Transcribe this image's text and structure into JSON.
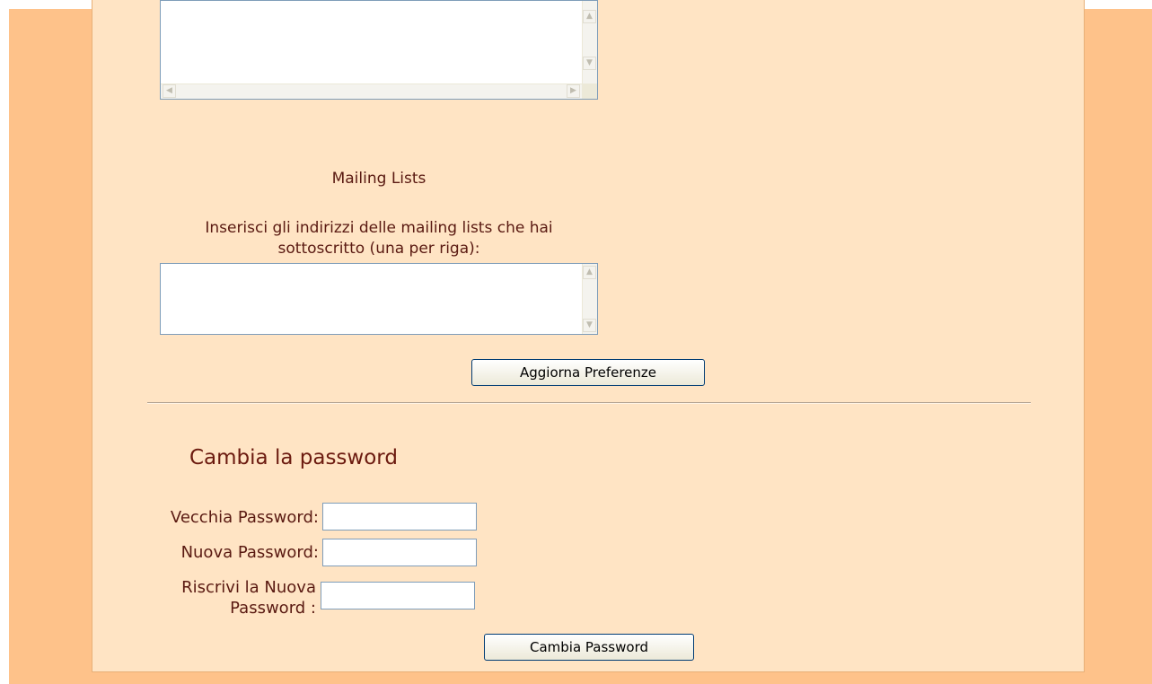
{
  "mailing": {
    "title": "Mailing Lists",
    "instruction_line1": "Inserisci gli indirizzi delle mailing lists che hai",
    "instruction_line2": "sottoscritto (una per riga):"
  },
  "preferences": {
    "update_button": "Aggiorna Preferenze"
  },
  "password": {
    "heading": "Cambia la password",
    "old_label": "Vecchia Password:",
    "new_label": "Nuova Password:",
    "repeat_label_line1": "Riscrivi la Nuova",
    "repeat_label_line2": "Password :",
    "submit_button": "Cambia Password"
  },
  "colors": {
    "background": "#fec28a",
    "panel": "#ffe4c4",
    "text": "#6b1a0f"
  }
}
